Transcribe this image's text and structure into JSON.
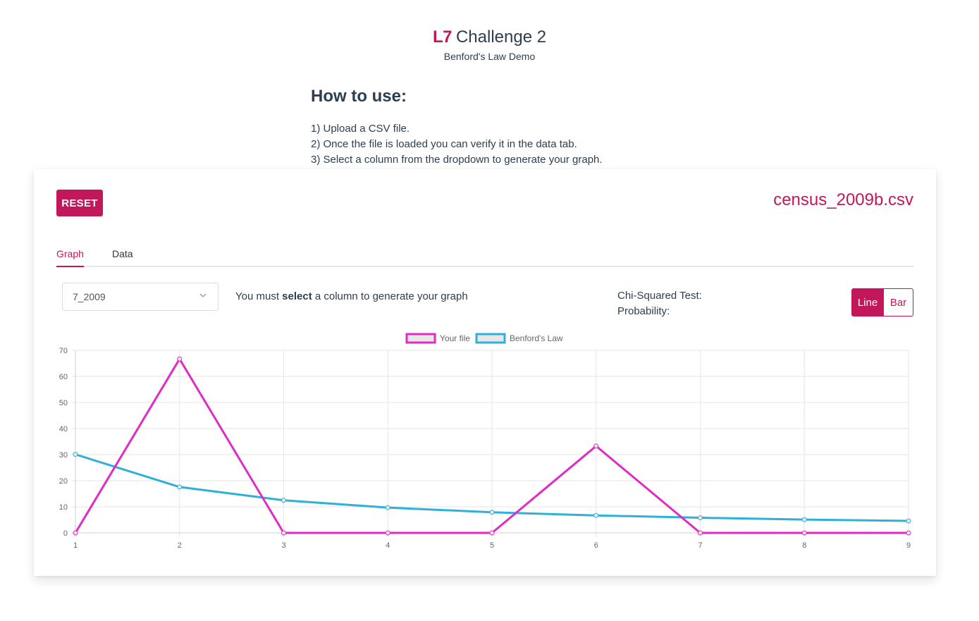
{
  "header": {
    "brand": "L7",
    "title": "Challenge 2",
    "subtitle": "Benford's Law Demo"
  },
  "howto": {
    "heading": "How to use:",
    "steps": [
      "1) Upload a CSV file.",
      "2) Once the file is loaded you can verify it in the data tab.",
      "3) Select a column from the dropdown to generate your graph."
    ]
  },
  "toolbar": {
    "reset_label": "RESET",
    "filename": "census_2009b.csv"
  },
  "tabs": [
    {
      "label": "Graph",
      "active": true
    },
    {
      "label": "Data",
      "active": false
    }
  ],
  "controls": {
    "column_select": {
      "selected": "7_2009"
    },
    "hint": {
      "prefix": "You must ",
      "bold": "select",
      "suffix": " a column to generate your graph"
    },
    "chi_squared_label": "Chi-Squared Test:",
    "probability_label": "Probability:",
    "view_toggle": {
      "options": [
        "Line",
        "Bar"
      ],
      "selected": "Line"
    }
  },
  "colors": {
    "accent": "#c2185b",
    "your_file": "#e02bc4",
    "benford": "#2fb0d8"
  },
  "chart_data": {
    "type": "line",
    "x": [
      1,
      2,
      3,
      4,
      5,
      6,
      7,
      8,
      9
    ],
    "series": [
      {
        "name": "Your file",
        "color": "#e02bc4",
        "values": [
          0,
          66.7,
          0,
          0,
          0,
          33.3,
          0,
          0,
          0
        ]
      },
      {
        "name": "Benford's Law",
        "color": "#2fb0d8",
        "values": [
          30.1,
          17.6,
          12.5,
          9.7,
          7.9,
          6.7,
          5.8,
          5.1,
          4.6
        ]
      }
    ],
    "ylim": [
      0,
      70
    ],
    "yticks": [
      0,
      10,
      20,
      30,
      40,
      50,
      60,
      70
    ],
    "grid": true,
    "legend": "top"
  }
}
